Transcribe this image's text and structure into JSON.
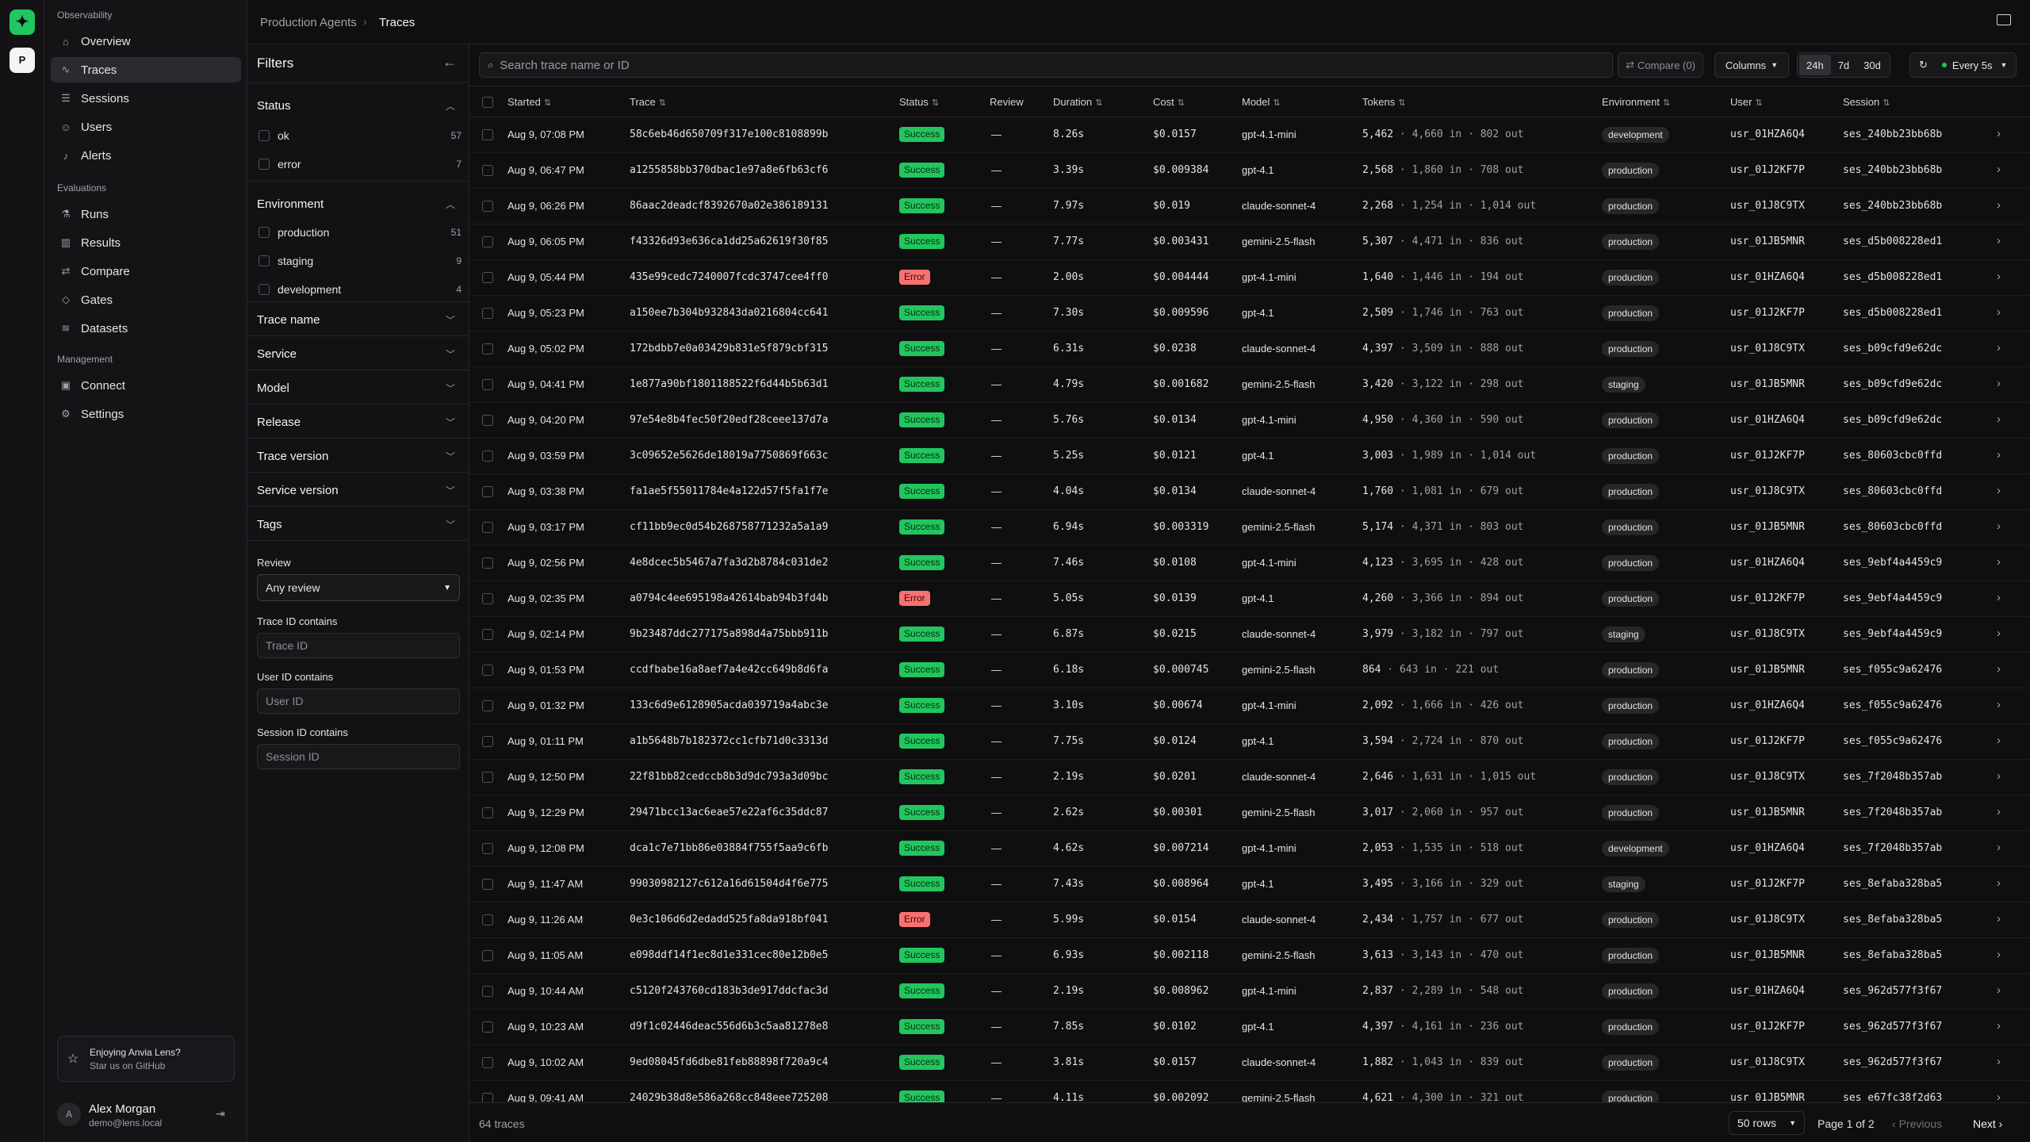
{
  "rail": {
    "logo_glyph": "✦",
    "project_initial": "P"
  },
  "sidebar": {
    "observability_title": "Observability",
    "evaluations_title": "Evaluations",
    "management_title": "Management",
    "items": [
      {
        "label": "Overview",
        "icon": "home-icon"
      },
      {
        "label": "Traces",
        "icon": "activity-icon"
      },
      {
        "label": "Sessions",
        "icon": "messages-icon"
      },
      {
        "label": "Users",
        "icon": "users-icon"
      },
      {
        "label": "Alerts",
        "icon": "bell-icon"
      },
      {
        "label": "Runs",
        "icon": "flask-icon"
      },
      {
        "label": "Results",
        "icon": "bar-chart-icon"
      },
      {
        "label": "Compare",
        "icon": "compare-icon"
      },
      {
        "label": "Gates",
        "icon": "shield-icon"
      },
      {
        "label": "Datasets",
        "icon": "database-icon"
      },
      {
        "label": "Connect",
        "icon": "terminal-icon"
      },
      {
        "label": "Settings",
        "icon": "gear-icon"
      }
    ],
    "promo": {
      "title": "Enjoying Anvia Lens?",
      "subtitle": "Star us on GitHub"
    },
    "user": {
      "initial": "A",
      "name": "Alex Morgan",
      "email": "demo@lens.local"
    }
  },
  "breadcrumb": {
    "parent": "Production Agents",
    "current": "Traces"
  },
  "filters": {
    "title": "Filters",
    "status": {
      "title": "Status",
      "options": [
        {
          "label": "ok",
          "count": "57"
        },
        {
          "label": "error",
          "count": "7"
        }
      ]
    },
    "environment": {
      "title": "Environment",
      "options": [
        {
          "label": "production",
          "count": "51"
        },
        {
          "label": "staging",
          "count": "9"
        },
        {
          "label": "development",
          "count": "4"
        }
      ]
    },
    "collapsed": [
      "Trace name",
      "Service",
      "Model",
      "Release",
      "Trace version",
      "Service version",
      "Tags"
    ],
    "review": {
      "label": "Review",
      "value": "Any review"
    },
    "trace_id": {
      "label": "Trace ID contains",
      "placeholder": "Trace ID"
    },
    "user_id": {
      "label": "User ID contains",
      "placeholder": "User ID"
    },
    "session_id": {
      "label": "Session ID contains",
      "placeholder": "Session ID"
    }
  },
  "toolbar": {
    "search_placeholder": "Search trace name or ID",
    "compare_label": "Compare (0)",
    "columns_label": "Columns",
    "ranges": [
      "24h",
      "7d",
      "30d"
    ],
    "active_range": "24h",
    "refresh_label": "Every 5s",
    "live_color": "#22c55e"
  },
  "table": {
    "headers": [
      "Started",
      "Trace",
      "Status",
      "Review",
      "Duration",
      "Cost",
      "Model",
      "Tokens",
      "Environment",
      "User",
      "Session"
    ],
    "rows": [
      [
        "Aug 9, 07:08 PM",
        "58c6eb46d650709f317e100c8108899b",
        "Success",
        "—",
        "8.26s",
        "$0.0157",
        "gpt-4.1-mini",
        "5,462",
        "4,660 in · 802 out",
        "development",
        "usr_01HZA6Q4",
        "ses_240bb23bb68b"
      ],
      [
        "Aug 9, 06:47 PM",
        "a1255858bb370dbac1e97a8e6fb63cf6",
        "Success",
        "—",
        "3.39s",
        "$0.009384",
        "gpt-4.1",
        "2,568",
        "1,860 in · 708 out",
        "production",
        "usr_01J2KF7P",
        "ses_240bb23bb68b"
      ],
      [
        "Aug 9, 06:26 PM",
        "86aac2deadcf8392670a02e386189131",
        "Success",
        "—",
        "7.97s",
        "$0.019",
        "claude-sonnet-4",
        "2,268",
        "1,254 in · 1,014 out",
        "production",
        "usr_01J8C9TX",
        "ses_240bb23bb68b"
      ],
      [
        "Aug 9, 06:05 PM",
        "f43326d93e636ca1dd25a62619f30f85",
        "Success",
        "—",
        "7.77s",
        "$0.003431",
        "gemini-2.5-flash",
        "5,307",
        "4,471 in · 836 out",
        "production",
        "usr_01JB5MNR",
        "ses_d5b008228ed1"
      ],
      [
        "Aug 9, 05:44 PM",
        "435e99cedc7240007fcdc3747cee4ff0",
        "Error",
        "—",
        "2.00s",
        "$0.004444",
        "gpt-4.1-mini",
        "1,640",
        "1,446 in · 194 out",
        "production",
        "usr_01HZA6Q4",
        "ses_d5b008228ed1"
      ],
      [
        "Aug 9, 05:23 PM",
        "a150ee7b304b932843da0216804cc641",
        "Success",
        "—",
        "7.30s",
        "$0.009596",
        "gpt-4.1",
        "2,509",
        "1,746 in · 763 out",
        "production",
        "usr_01J2KF7P",
        "ses_d5b008228ed1"
      ],
      [
        "Aug 9, 05:02 PM",
        "172bdbb7e0a03429b831e5f879cbf315",
        "Success",
        "—",
        "6.31s",
        "$0.0238",
        "claude-sonnet-4",
        "4,397",
        "3,509 in · 888 out",
        "production",
        "usr_01J8C9TX",
        "ses_b09cfd9e62dc"
      ],
      [
        "Aug 9, 04:41 PM",
        "1e877a90bf1801188522f6d44b5b63d1",
        "Success",
        "—",
        "4.79s",
        "$0.001682",
        "gemini-2.5-flash",
        "3,420",
        "3,122 in · 298 out",
        "staging",
        "usr_01JB5MNR",
        "ses_b09cfd9e62dc"
      ],
      [
        "Aug 9, 04:20 PM",
        "97e54e8b4fec50f20edf28ceee137d7a",
        "Success",
        "—",
        "5.76s",
        "$0.0134",
        "gpt-4.1-mini",
        "4,950",
        "4,360 in · 590 out",
        "production",
        "usr_01HZA6Q4",
        "ses_b09cfd9e62dc"
      ],
      [
        "Aug 9, 03:59 PM",
        "3c09652e5626de18019a7750869f663c",
        "Success",
        "—",
        "5.25s",
        "$0.0121",
        "gpt-4.1",
        "3,003",
        "1,989 in · 1,014 out",
        "production",
        "usr_01J2KF7P",
        "ses_80603cbc0ffd"
      ],
      [
        "Aug 9, 03:38 PM",
        "fa1ae5f55011784e4a122d57f5fa1f7e",
        "Success",
        "—",
        "4.04s",
        "$0.0134",
        "claude-sonnet-4",
        "1,760",
        "1,081 in · 679 out",
        "production",
        "usr_01J8C9TX",
        "ses_80603cbc0ffd"
      ],
      [
        "Aug 9, 03:17 PM",
        "cf11bb9ec0d54b268758771232a5a1a9",
        "Success",
        "—",
        "6.94s",
        "$0.003319",
        "gemini-2.5-flash",
        "5,174",
        "4,371 in · 803 out",
        "production",
        "usr_01JB5MNR",
        "ses_80603cbc0ffd"
      ],
      [
        "Aug 9, 02:56 PM",
        "4e8dcec5b5467a7fa3d2b8784c031de2",
        "Success",
        "—",
        "7.46s",
        "$0.0108",
        "gpt-4.1-mini",
        "4,123",
        "3,695 in · 428 out",
        "production",
        "usr_01HZA6Q4",
        "ses_9ebf4a4459c9"
      ],
      [
        "Aug 9, 02:35 PM",
        "a0794c4ee695198a42614bab94b3fd4b",
        "Error",
        "—",
        "5.05s",
        "$0.0139",
        "gpt-4.1",
        "4,260",
        "3,366 in · 894 out",
        "production",
        "usr_01J2KF7P",
        "ses_9ebf4a4459c9"
      ],
      [
        "Aug 9, 02:14 PM",
        "9b23487ddc277175a898d4a75bbb911b",
        "Success",
        "—",
        "6.87s",
        "$0.0215",
        "claude-sonnet-4",
        "3,979",
        "3,182 in · 797 out",
        "staging",
        "usr_01J8C9TX",
        "ses_9ebf4a4459c9"
      ],
      [
        "Aug 9, 01:53 PM",
        "ccdfbabe16a8aef7a4e42cc649b8d6fa",
        "Success",
        "—",
        "6.18s",
        "$0.000745",
        "gemini-2.5-flash",
        "864",
        "643 in · 221 out",
        "production",
        "usr_01JB5MNR",
        "ses_f055c9a62476"
      ],
      [
        "Aug 9, 01:32 PM",
        "133c6d9e6128905acda039719a4abc3e",
        "Success",
        "—",
        "3.10s",
        "$0.00674",
        "gpt-4.1-mini",
        "2,092",
        "1,666 in · 426 out",
        "production",
        "usr_01HZA6Q4",
        "ses_f055c9a62476"
      ],
      [
        "Aug 9, 01:11 PM",
        "a1b5648b7b182372cc1cfb71d0c3313d",
        "Success",
        "—",
        "7.75s",
        "$0.0124",
        "gpt-4.1",
        "3,594",
        "2,724 in · 870 out",
        "production",
        "usr_01J2KF7P",
        "ses_f055c9a62476"
      ],
      [
        "Aug 9, 12:50 PM",
        "22f81bb82cedccb8b3d9dc793a3d09bc",
        "Success",
        "—",
        "2.19s",
        "$0.0201",
        "claude-sonnet-4",
        "2,646",
        "1,631 in · 1,015 out",
        "production",
        "usr_01J8C9TX",
        "ses_7f2048b357ab"
      ],
      [
        "Aug 9, 12:29 PM",
        "29471bcc13ac6eae57e22af6c35ddc87",
        "Success",
        "—",
        "2.62s",
        "$0.00301",
        "gemini-2.5-flash",
        "3,017",
        "2,060 in · 957 out",
        "production",
        "usr_01JB5MNR",
        "ses_7f2048b357ab"
      ],
      [
        "Aug 9, 12:08 PM",
        "dca1c7e71bb86e03884f755f5aa9c6fb",
        "Success",
        "—",
        "4.62s",
        "$0.007214",
        "gpt-4.1-mini",
        "2,053",
        "1,535 in · 518 out",
        "development",
        "usr_01HZA6Q4",
        "ses_7f2048b357ab"
      ],
      [
        "Aug 9, 11:47 AM",
        "99030982127c612a16d61504d4f6e775",
        "Success",
        "—",
        "7.43s",
        "$0.008964",
        "gpt-4.1",
        "3,495",
        "3,166 in · 329 out",
        "staging",
        "usr_01J2KF7P",
        "ses_8efaba328ba5"
      ],
      [
        "Aug 9, 11:26 AM",
        "0e3c106d6d2edadd525fa8da918bf041",
        "Error",
        "—",
        "5.99s",
        "$0.0154",
        "claude-sonnet-4",
        "2,434",
        "1,757 in · 677 out",
        "production",
        "usr_01J8C9TX",
        "ses_8efaba328ba5"
      ],
      [
        "Aug 9, 11:05 AM",
        "e098ddf14f1ec8d1e331cec80e12b0e5",
        "Success",
        "—",
        "6.93s",
        "$0.002118",
        "gemini-2.5-flash",
        "3,613",
        "3,143 in · 470 out",
        "production",
        "usr_01JB5MNR",
        "ses_8efaba328ba5"
      ],
      [
        "Aug 9, 10:44 AM",
        "c5120f243760cd183b3de917ddcfac3d",
        "Success",
        "—",
        "2.19s",
        "$0.008962",
        "gpt-4.1-mini",
        "2,837",
        "2,289 in · 548 out",
        "production",
        "usr_01HZA6Q4",
        "ses_962d577f3f67"
      ],
      [
        "Aug 9, 10:23 AM",
        "d9f1c02446deac556d6b3c5aa81278e8",
        "Success",
        "—",
        "7.85s",
        "$0.0102",
        "gpt-4.1",
        "4,397",
        "4,161 in · 236 out",
        "production",
        "usr_01J2KF7P",
        "ses_962d577f3f67"
      ],
      [
        "Aug 9, 10:02 AM",
        "9ed08045fd6dbe81feb88898f720a9c4",
        "Success",
        "—",
        "3.81s",
        "$0.0157",
        "claude-sonnet-4",
        "1,882",
        "1,043 in · 839 out",
        "production",
        "usr_01J8C9TX",
        "ses_962d577f3f67"
      ],
      [
        "Aug 9, 09:41 AM",
        "24029b38d8e586a268cc848eee725208",
        "Success",
        "—",
        "4.11s",
        "$0.002092",
        "gemini-2.5-flash",
        "4,621",
        "4,300 in · 321 out",
        "production",
        "usr_01JB5MNR",
        "ses_e67fc38f2d63"
      ]
    ]
  },
  "footer": {
    "count": "64 traces",
    "rows_label": "50 rows",
    "page_label": "Page 1 of 2",
    "prev_label": "Previous",
    "next_label": "Next"
  }
}
